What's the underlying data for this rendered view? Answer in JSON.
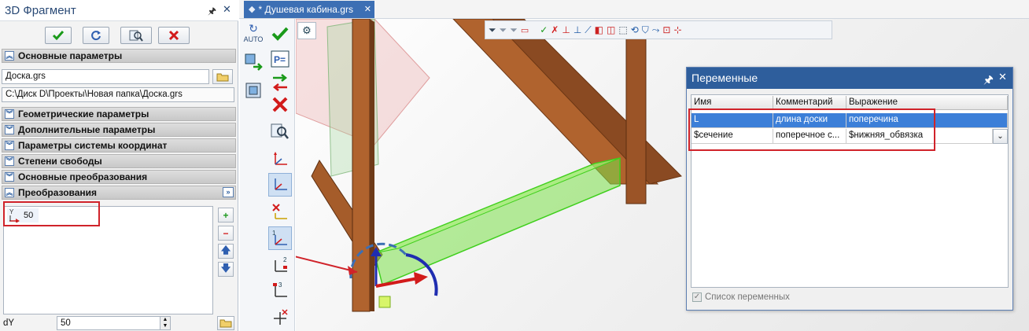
{
  "left_panel": {
    "title": "3D Фрагмент",
    "pin_icon": "pin-icon",
    "close_icon": "close-icon",
    "toolbar": [
      "ok-icon",
      "refresh-icon",
      "preview-icon",
      "cancel-icon"
    ],
    "sections": {
      "main": "Основные параметры",
      "geom": "Геометрические параметры",
      "extra": "Дополнительные параметры",
      "cs": "Параметры системы координат",
      "dof": "Степени свободы",
      "transforms_main": "Основные преобразования",
      "transforms": "Преобразования"
    },
    "file_value": "Доска.grs",
    "path_value": "C:\\Диск D\\Проекты\\Новая папка\\Доска.grs",
    "transform_item": {
      "axis_icon": "y-axis-arrow-icon",
      "value": "50"
    },
    "dy_label": "dY",
    "dy_value": "50"
  },
  "document_tab": {
    "label": "* Душевая кабина.grs",
    "icon": "model-icon"
  },
  "tool_column": {
    "auto_label": "AUTO"
  },
  "vars_window": {
    "title": "Переменные",
    "columns": [
      "Имя",
      "Комментарий",
      "Выражение"
    ],
    "rows": [
      {
        "name": "L",
        "comment": "длина доски",
        "expression": "поперечина",
        "selected": true
      },
      {
        "name": "$сечение",
        "comment": "поперечное с...",
        "expression": "$нижняя_обвязка",
        "selected": false
      }
    ],
    "checkbox_label": "Список переменных",
    "checkbox_checked": true
  },
  "colors": {
    "accent": "#2e5e9c",
    "selection": "#3c7fd8",
    "annotation": "#d0232a",
    "wood": "#8a4a22",
    "highlight": "#7be04a"
  }
}
